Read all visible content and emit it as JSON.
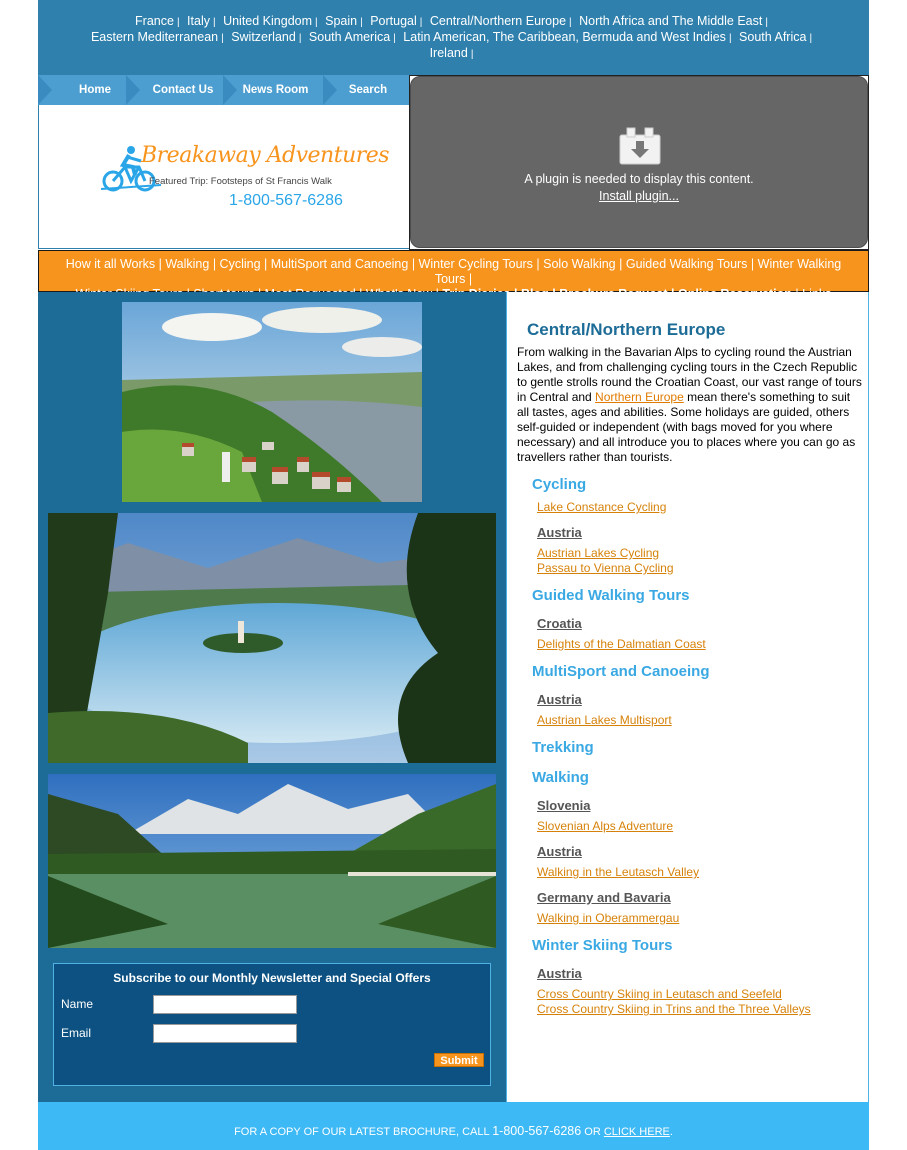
{
  "countries": [
    "France",
    "Italy",
    "United Kingdom",
    "Spain",
    "Portugal",
    "Central/Northern Europe",
    "North Africa and The Middle East",
    "Eastern Mediterranean",
    "Switzerland",
    "South America",
    "Latin American, The Caribbean, Bermuda and West Indies",
    "South Africa",
    "Ireland"
  ],
  "nav": [
    "Home",
    "Contact Us",
    "News Room",
    "Search"
  ],
  "logo": {
    "brand": "Breakaway Adventures",
    "featured": "Featured Trip: Footsteps of St Francis Walk",
    "phone": "1-800-567-6286"
  },
  "plugin": {
    "message": "A plugin is needed to display this content.",
    "install": "Install plugin..."
  },
  "orangebar": {
    "line1": [
      "How it all Works",
      "Walking",
      "Cycling",
      "MultiSport and Canoeing",
      "Winter Cycling Tours",
      "Solo Walking",
      "Guided Walking Tours",
      "Winter Walking Tours"
    ],
    "line2_plain": [
      "Winter Skiing Tours",
      "Short tours",
      "Most Requested",
      "What's New"
    ],
    "line2_bold": [
      "Trip Diaries",
      "Blog",
      "Brochure Request",
      "Online Reservation"
    ],
    "line2_end": "Links"
  },
  "newsletter": {
    "title": "Subscribe to our Monthly Newsletter and Special Offers",
    "name_label": "Name",
    "email_label": "Email",
    "submit": "Submit"
  },
  "content": {
    "heading": "Central/Northern Europe",
    "intro_before": "From walking in the Bavarian Alps to cycling round the Austrian Lakes, and from challenging cycling tours in the Czech Republic to gentle strolls round the Croatian Coast, our vast range of tours in Central and ",
    "intro_link": "Northern Europe",
    "intro_after": " mean there's something to suit all tastes, ages and abilities. Some holidays are guided, others self-guided or independent (with bags moved for you where necessary) and all introduce you to places where you can go as travellers rather than tourists.",
    "sections": {
      "cycling": "Cycling",
      "cycling_link1": "Lake Constance Cycling",
      "cycling_sub1": "Austria",
      "cycling_link2": "Austrian Lakes Cycling",
      "cycling_link3": "Passau to Vienna Cycling",
      "guided": "Guided Walking Tours",
      "guided_sub1": "Croatia",
      "guided_link1": "Delights of the Dalmatian Coast",
      "multi": "MultiSport and Canoeing",
      "multi_sub1": "Austria",
      "multi_link1": "Austrian Lakes Multisport",
      "trekking": "Trekking",
      "walking": "Walking",
      "walking_sub1": "Slovenia",
      "walking_link1": "Slovenian Alps Adventure",
      "walking_sub2": "Austria",
      "walking_link2": "Walking in the Leutasch Valley",
      "walking_sub3": "Germany and Bavaria",
      "walking_link3": "Walking in Oberammergau",
      "skiing": "Winter Skiing Tours",
      "skiing_sub1": "Austria",
      "skiing_link1": "Cross Country Skiing in Leutasch and Seefeld",
      "skiing_link2": "Cross Country Skiing in Trins and the Three Valleys"
    }
  },
  "footer": {
    "before": "FOR A COPY OF OUR LATEST BROCHURE, CALL ",
    "phone": "1-800-567-6286",
    "middle": " OR ",
    "link": "CLICK HERE",
    "end": "."
  },
  "colors": {
    "topbar": "#2f80ad",
    "orange": "#f7941d",
    "leftcol": "#1d6c97",
    "footer": "#3db9f6",
    "section": "#3aa9e3"
  }
}
